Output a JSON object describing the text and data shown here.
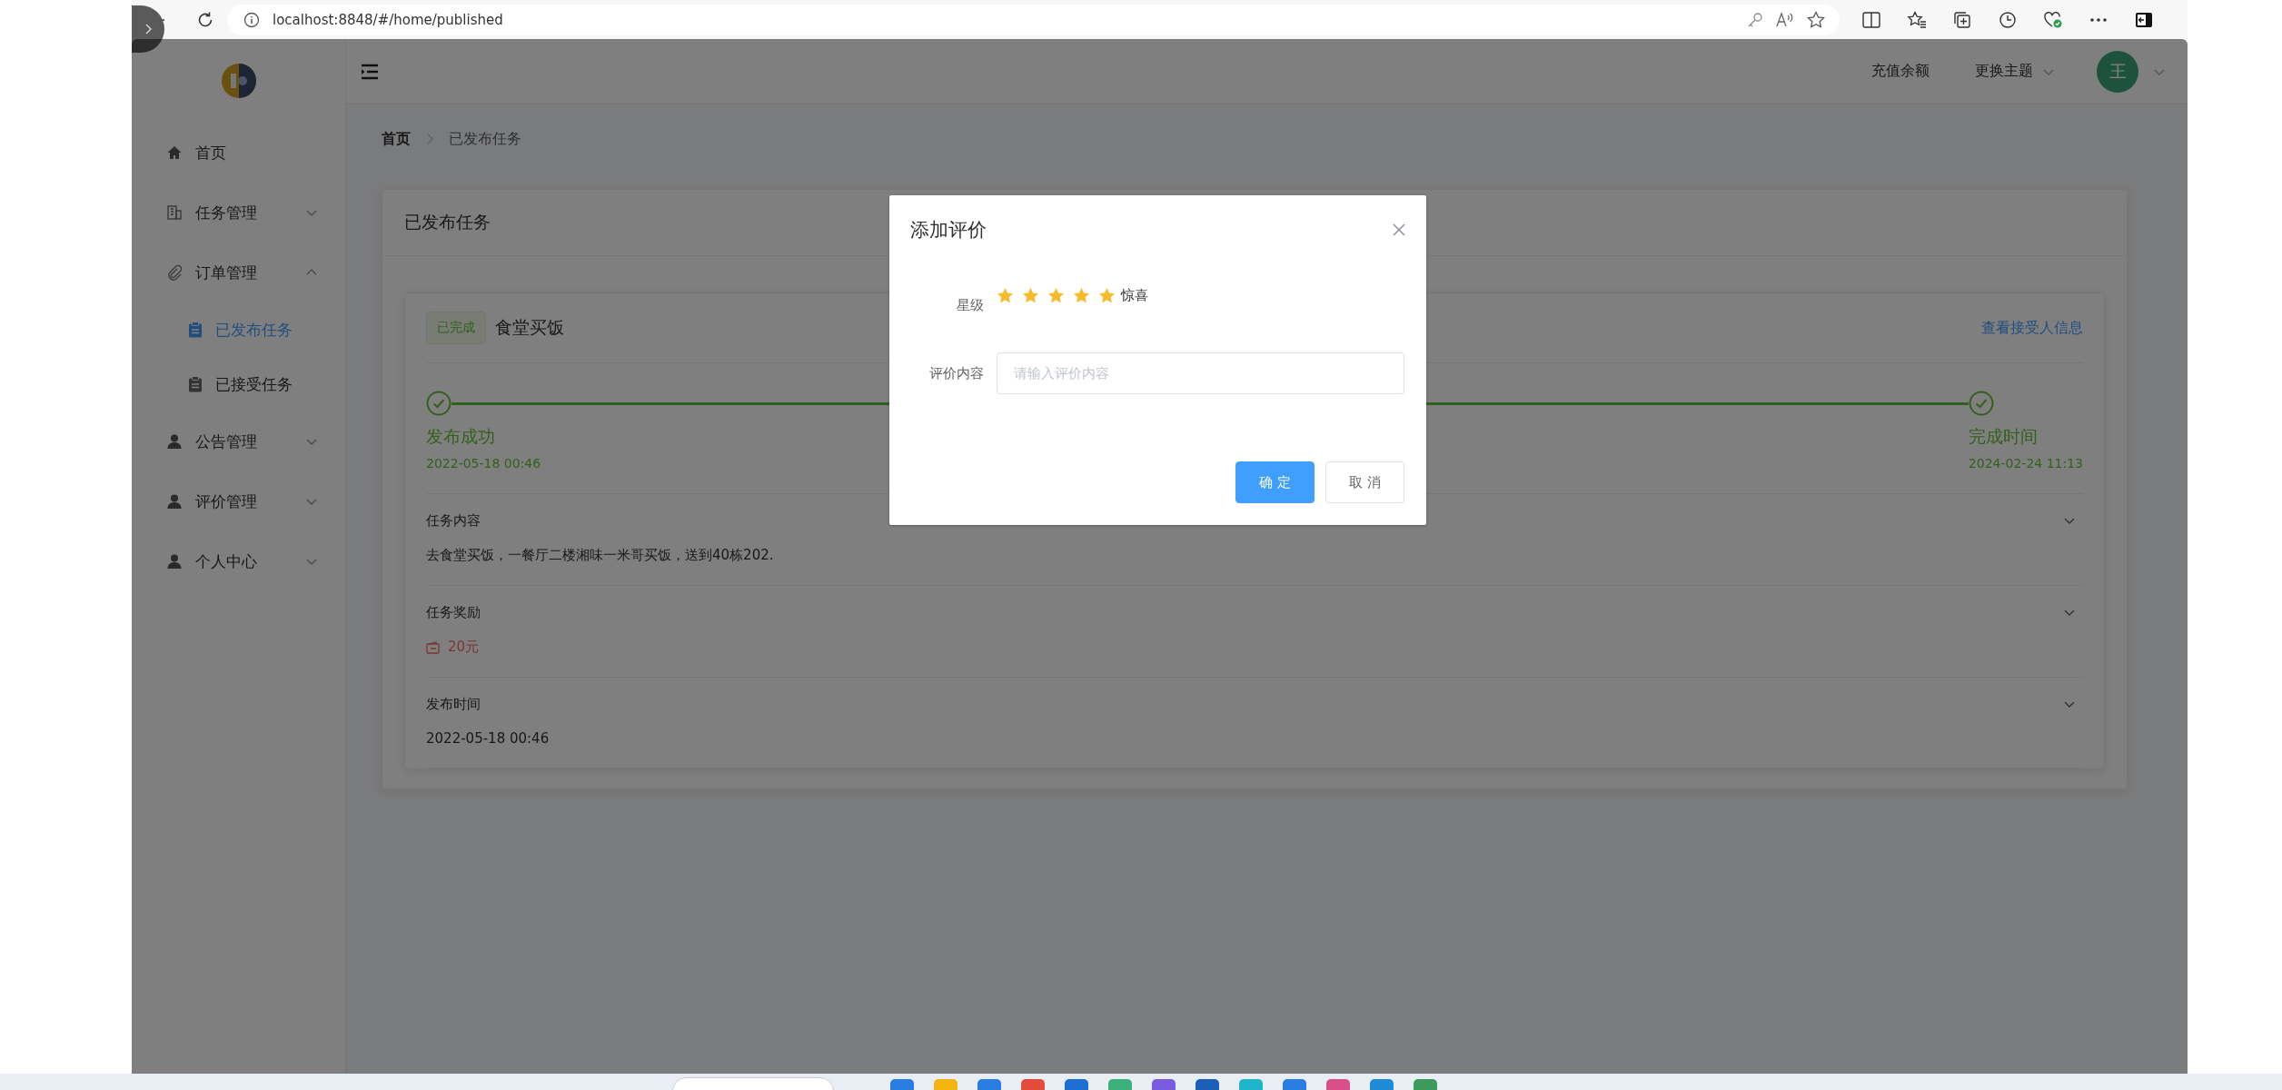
{
  "browser": {
    "url": "localhost:8848/#/home/published"
  },
  "sidebar": {
    "items": [
      {
        "label": "首页",
        "kind": "link"
      },
      {
        "label": "任务管理",
        "kind": "group",
        "expanded": false
      },
      {
        "label": "订单管理",
        "kind": "group",
        "expanded": true,
        "children": [
          {
            "label": "已发布任务",
            "selected": true
          },
          {
            "label": "已接受任务",
            "selected": false
          }
        ]
      },
      {
        "label": "公告管理",
        "kind": "group",
        "expanded": false
      },
      {
        "label": "评价管理",
        "kind": "group",
        "expanded": false
      },
      {
        "label": "个人中心",
        "kind": "group",
        "expanded": false
      }
    ]
  },
  "header": {
    "recharge": "充值余额",
    "theme": "更换主题",
    "avatar": "王"
  },
  "breadcrumb": [
    {
      "label": "首页",
      "current": false
    },
    {
      "label": "已发布任务",
      "current": true
    }
  ],
  "page": {
    "title": "已发布任务",
    "task": {
      "status": "已完成",
      "title": "食堂买饭",
      "link": "查看接受人信息",
      "steps": [
        {
          "title": "发布成功",
          "time": "2022-05-18 00:46",
          "done": true
        },
        {
          "title": "完成时间",
          "time": "2024-02-24 11:13",
          "done": true
        }
      ],
      "sections": [
        {
          "title": "任务内容",
          "content": "去食堂买饭，一餐厅二楼湘味一米哥买饭，送到40栋202.",
          "kind": "text",
          "expanded": true
        },
        {
          "title": "任务奖励",
          "content": "20元",
          "kind": "money",
          "expanded": true
        },
        {
          "title": "发布时间",
          "content": "2022-05-18 00:46",
          "kind": "text",
          "expanded": true
        }
      ]
    }
  },
  "dialog": {
    "title": "添加评价",
    "rating": {
      "label": "星级",
      "stars": 5,
      "text": "惊喜"
    },
    "comment": {
      "label": "评价内容",
      "placeholder": "请输入评价内容"
    },
    "buttons": [
      {
        "label": "确 定",
        "kind": "primary"
      },
      {
        "label": "取 消",
        "kind": "default"
      }
    ]
  }
}
